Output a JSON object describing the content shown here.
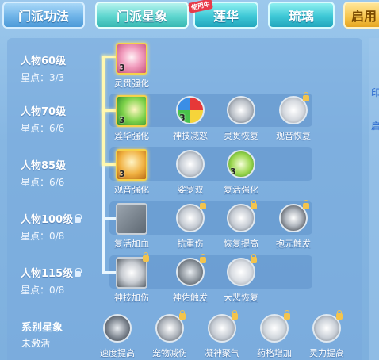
{
  "tabs": [
    {
      "label": "门派功法",
      "style": "blue"
    },
    {
      "label": "门派星象",
      "style": "active"
    },
    {
      "label": "莲华",
      "style": "cyan",
      "badge": "使用中"
    },
    {
      "label": "琉璃",
      "style": "cyan"
    },
    {
      "label": "启用",
      "style": "yellow"
    }
  ],
  "rows": [
    {
      "level": "人物60级",
      "points": "星点：3/3"
    },
    {
      "level": "人物70级",
      "points": "星点：6/6"
    },
    {
      "level": "人物85级",
      "points": "星点：6/6"
    },
    {
      "level": "人物100级",
      "points": "星点：0/8",
      "locked": true
    },
    {
      "level": "人物115级",
      "points": "星点：0/8",
      "locked": true
    }
  ],
  "skills": {
    "r1": [
      {
        "name": "灵贯强化",
        "count": "3"
      }
    ],
    "r2": [
      {
        "name": "莲华强化",
        "count": "3"
      },
      {
        "name": "神技减怒",
        "count": "3"
      },
      {
        "name": "灵贯恢复"
      },
      {
        "name": "观音恢复"
      }
    ],
    "r3": [
      {
        "name": "观音强化",
        "count": "3"
      },
      {
        "name": "娑罗双"
      },
      {
        "name": "复活强化",
        "count": "3"
      }
    ],
    "r4": [
      {
        "name": "复活加血"
      },
      {
        "name": "抗重伤"
      },
      {
        "name": "恢复提高"
      },
      {
        "name": "抱元触发"
      }
    ],
    "r5": [
      {
        "name": "神技加伤"
      },
      {
        "name": "神佑触发"
      },
      {
        "name": "大悲恢复"
      }
    ]
  },
  "system": {
    "title": "系别星象",
    "status": "未激活",
    "items": [
      {
        "name": "速度提高"
      },
      {
        "name": "宠物减伤"
      },
      {
        "name": "凝神聚气"
      },
      {
        "name": "药格增加"
      },
      {
        "name": "灵力提高"
      }
    ]
  },
  "right_text": [
    "印",
    "启"
  ]
}
